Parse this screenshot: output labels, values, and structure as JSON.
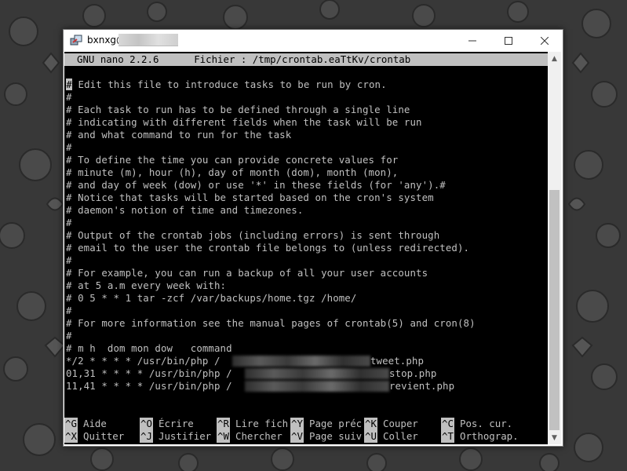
{
  "window": {
    "title": "bxnxg@"
  },
  "nano": {
    "header": "GNU nano 2.2.6      Fichier : /tmp/crontab.eaTtKv/crontab",
    "cursor_char": "#",
    "lines": [
      " Edit this file to introduce tasks to be run by cron.",
      "#",
      "# Each task to run has to be defined through a single line",
      "# indicating with different fields when the task will be run",
      "# and what command to run for the task",
      "#",
      "# To define the time you can provide concrete values for",
      "# minute (m), hour (h), day of month (dom), month (mon),",
      "# and day of week (dow) or use '*' in these fields (for 'any').#",
      "# Notice that tasks will be started based on the cron's system",
      "# daemon's notion of time and timezones.",
      "#",
      "# Output of the crontab jobs (including errors) is sent through",
      "# email to the user the crontab file belongs to (unless redirected).",
      "#",
      "# For example, you can run a backup of all your user accounts",
      "# at 5 a.m every week with:",
      "# 0 5 * * 1 tar -zcf /var/backups/home.tgz /home/",
      "#",
      "# For more information see the manual pages of crontab(5) and cron(8)",
      "#",
      "# m h  dom mon dow   command"
    ],
    "cron_jobs": [
      {
        "prefix": "*/2 * * * * /usr/bin/php /",
        "suffix": "tweet.php"
      },
      {
        "prefix": "01,31 * * * * /usr/bin/php /",
        "suffix": "stop.php"
      },
      {
        "prefix": "11,41 * * * * /usr/bin/php /",
        "suffix": "revient.php"
      }
    ],
    "shortcuts_row1": [
      {
        "key": "^G",
        "label": "Aide"
      },
      {
        "key": "^O",
        "label": "Écrire"
      },
      {
        "key": "^R",
        "label": "Lire fich"
      },
      {
        "key": "^Y",
        "label": "Page préc"
      },
      {
        "key": "^K",
        "label": "Couper"
      },
      {
        "key": "^C",
        "label": "Pos. cur."
      }
    ],
    "shortcuts_row2": [
      {
        "key": "^X",
        "label": "Quitter"
      },
      {
        "key": "^J",
        "label": "Justifier"
      },
      {
        "key": "^W",
        "label": "Chercher"
      },
      {
        "key": "^V",
        "label": "Page suiv"
      },
      {
        "key": "^U",
        "label": "Coller"
      },
      {
        "key": "^T",
        "label": "Orthograp."
      }
    ]
  },
  "icons": {
    "app": "putty-icon",
    "minimize": "minimize-icon",
    "maximize": "maximize-icon",
    "close": "close-icon",
    "scroll_up": "scroll-up-icon",
    "scroll_down": "scroll-down-icon"
  }
}
